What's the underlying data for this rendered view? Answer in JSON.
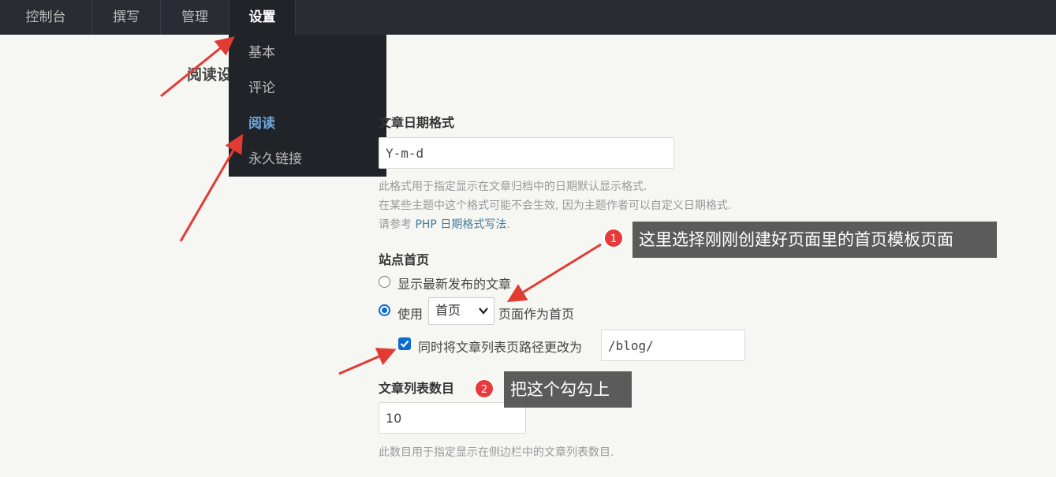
{
  "nav": {
    "items": [
      {
        "label": "控制台"
      },
      {
        "label": "撰写"
      },
      {
        "label": "管理"
      },
      {
        "label": "设置"
      }
    ],
    "active": "设置"
  },
  "dropdown": {
    "items": [
      {
        "label": "基本"
      },
      {
        "label": "评论"
      },
      {
        "label": "阅读"
      },
      {
        "label": "永久链接"
      }
    ],
    "active": "阅读"
  },
  "page": {
    "title": "阅读设置"
  },
  "date_format": {
    "label": "文章日期格式",
    "value": "Y-m-d",
    "desc_line1": "此格式用于指定显示在文章归档中的日期默认显示格式.",
    "desc_line2": "在某些主题中这个格式可能不会生效, 因为主题作者可以自定义日期格式.",
    "desc_line3_prefix": "请参考",
    "desc_line3_link": "PHP 日期格式写法",
    "desc_line3_suffix": "."
  },
  "front_page": {
    "label": "站点首页",
    "option_latest": "显示最新发布的文章",
    "option_page_prefix": "使用",
    "option_page_select": "首页",
    "option_page_suffix": "页面作为首页",
    "checkbox_label": "同时将文章列表页路径更改为",
    "path_value": "/blog/"
  },
  "post_count": {
    "label": "文章列表数目",
    "value": "10",
    "desc": "此数目用于指定显示在侧边栏中的文章列表数目."
  },
  "annotations": {
    "badge1": "1",
    "callout1": "这里选择刚刚创建好页面里的首页模板页面",
    "badge2": "2",
    "callout2": "把这个勾勾上",
    "arrow_color": "#e23b34"
  },
  "colors": {
    "topbar": "#292d33",
    "dropdown": "#202327",
    "accent": "#0b6bd3",
    "link": "#467b96"
  }
}
